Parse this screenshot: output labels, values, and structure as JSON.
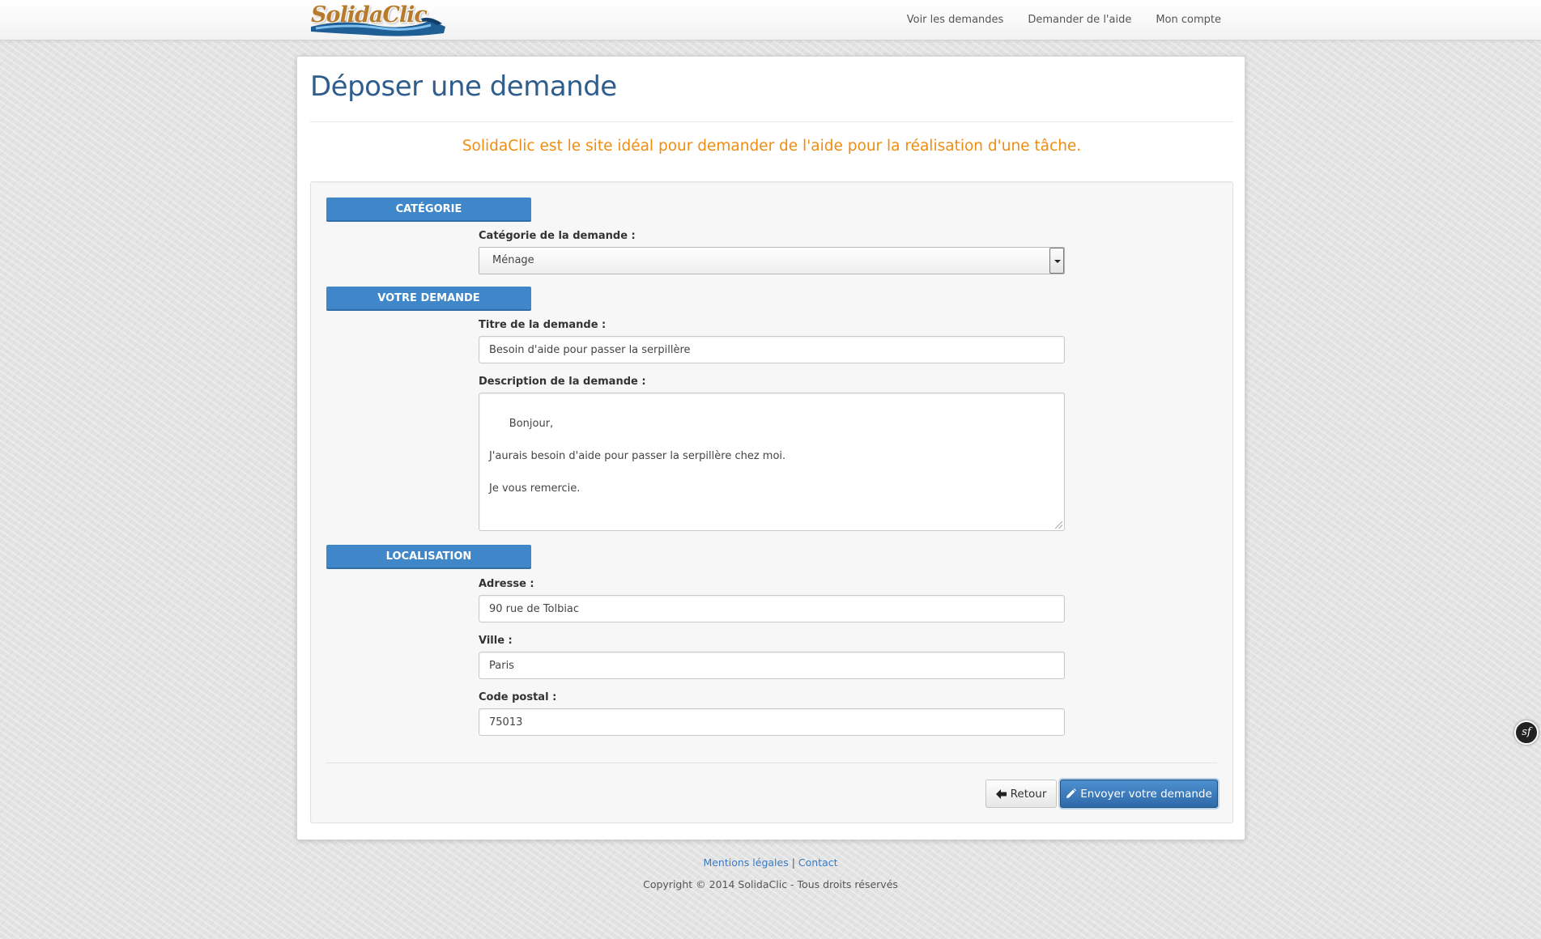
{
  "brand": {
    "name": "SolidaClic"
  },
  "nav": {
    "items": [
      {
        "label": "Voir les demandes"
      },
      {
        "label": "Demander de l'aide"
      },
      {
        "label": "Mon compte"
      }
    ]
  },
  "page": {
    "title": "Déposer une demande",
    "tagline": "SolidaClic est le site idéal pour demander de l'aide pour la réalisation d'une tâche."
  },
  "form": {
    "sections": {
      "category": "CATÉGORIE",
      "request": "VOTRE DEMANDE",
      "location": "LOCALISATION"
    },
    "category": {
      "label": "Catégorie de la demande :",
      "selected": "Ménage"
    },
    "title": {
      "label": "Titre de la demande :",
      "value": "Besoin d'aide pour passer la serpillère"
    },
    "description": {
      "label": "Description de la demande :",
      "value": "Bonjour,\n\nJ'aurais besoin d'aide pour passer la serpillère chez moi.\n\nJe vous remercie."
    },
    "address": {
      "label": "Adresse :",
      "value": "90 rue de Tolbiac"
    },
    "city": {
      "label": "Ville :",
      "value": "Paris"
    },
    "postal_code": {
      "label": "Code postal :",
      "value": "75013"
    },
    "buttons": {
      "back": "Retour",
      "submit": "Envoyer votre demande"
    }
  },
  "footer": {
    "legal": "Mentions légales",
    "separator": "|",
    "contact": "Contact",
    "copyright": "Copyright © 2014 SolidaClic - Tous droits réservés"
  },
  "debug": {
    "symfony_label": "sf"
  },
  "colors": {
    "accent": "#3f87c9",
    "title": "#2f5e8c",
    "tagline": "#f28c0f",
    "link": "#3a7bc1"
  }
}
